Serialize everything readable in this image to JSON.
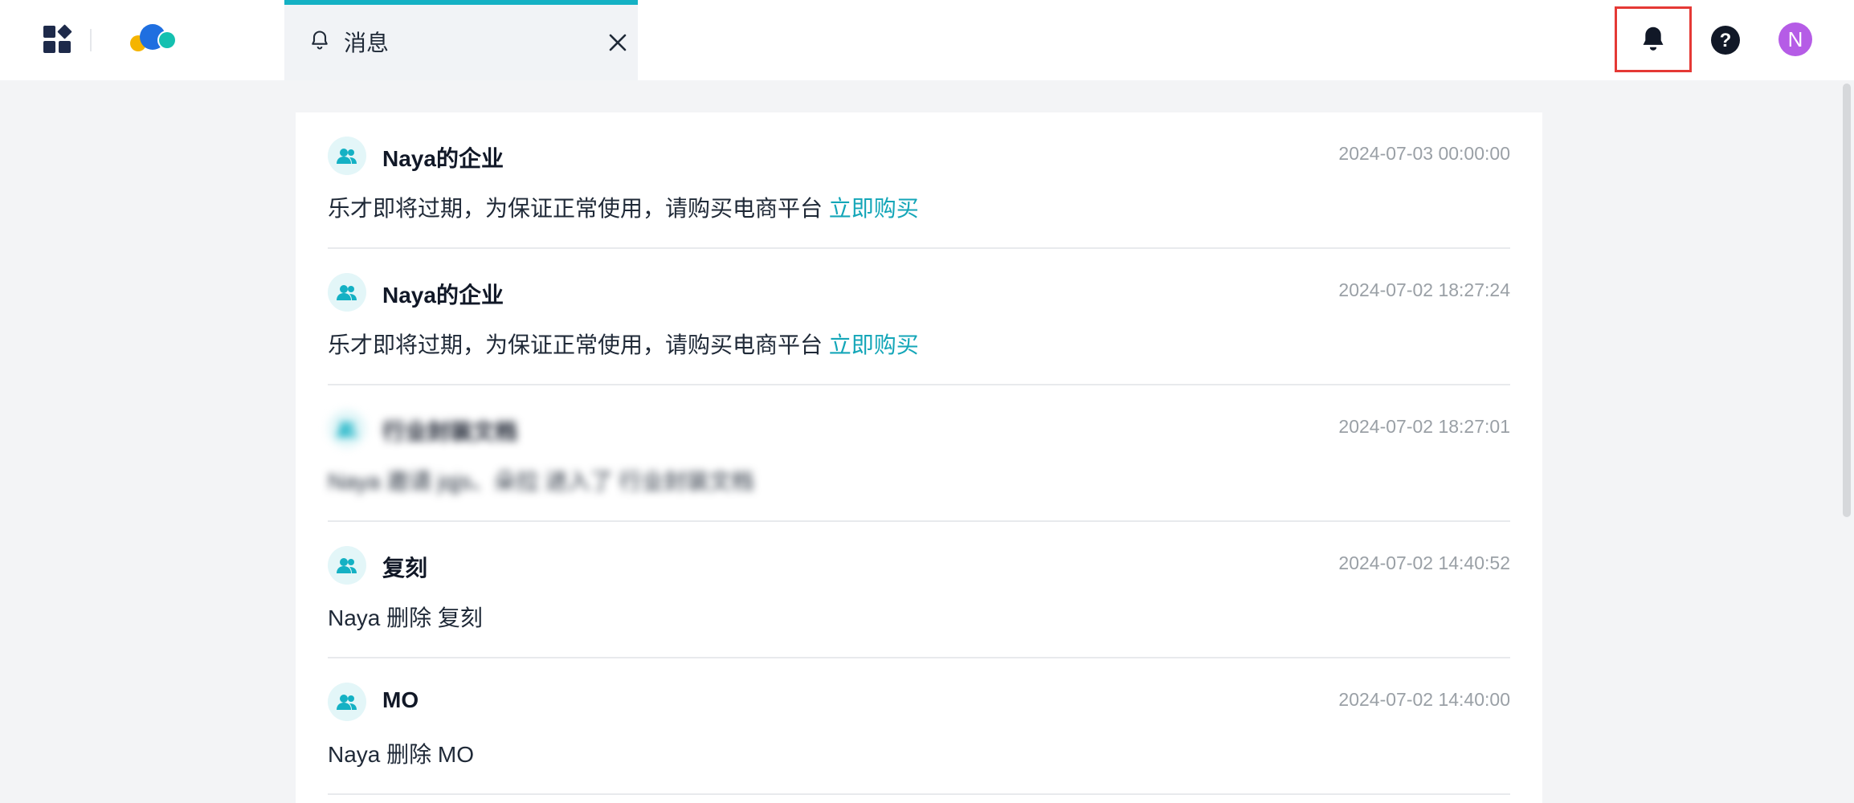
{
  "header": {
    "tab_label": "消息",
    "avatar_initial": "N"
  },
  "messages": [
    {
      "group": "Naya的企业",
      "time": "2024-07-03 00:00:00",
      "text": "乐才即将过期，为保证正常使用，请购买电商平台",
      "link": "立即购买",
      "blurred": false
    },
    {
      "group": "Naya的企业",
      "time": "2024-07-02 18:27:24",
      "text": "乐才即将过期，为保证正常使用，请购买电商平台",
      "link": "立即购买",
      "blurred": false
    },
    {
      "group": "行业封装文档",
      "time": "2024-07-02 18:27:01",
      "text": "Naya 邀请 jqjs、朵拉 进入了 行业封装文档",
      "link": "",
      "blurred": true
    },
    {
      "group": "复刻",
      "time": "2024-07-02 14:40:52",
      "text": "Naya 删除 复刻",
      "link": "",
      "blurred": false
    },
    {
      "group": "MO",
      "time": "2024-07-02 14:40:00",
      "text": "Naya 删除 MO",
      "link": "",
      "blurred": false
    }
  ],
  "colors": {
    "accent": "#14b1c4",
    "link": "#14a6b8",
    "highlight_box": "#e53935",
    "avatar_bg": "#b55ce6"
  }
}
